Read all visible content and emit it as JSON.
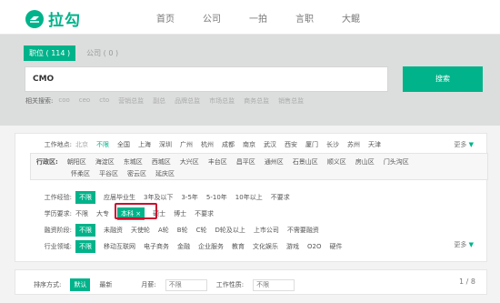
{
  "brand": {
    "name": "拉勾",
    "color": "#00b38a"
  },
  "nav": [
    "首页",
    "公司",
    "一拍",
    "言职",
    "大鲲"
  ],
  "tabs": [
    {
      "label": "职位 ( 114 )",
      "active": true
    },
    {
      "label": "公司 ( 0 )",
      "active": false
    }
  ],
  "search": {
    "value": "CMO",
    "button": "搜索"
  },
  "related": {
    "label": "相关搜索:",
    "tags": [
      "coo",
      "ceo",
      "cto",
      "营销总监",
      "副总",
      "品牌总监",
      "市场总监",
      "商务总监",
      "销售总监"
    ]
  },
  "filters": {
    "location": {
      "label": "工作地点:",
      "current": "北京",
      "options": [
        "不限",
        "全国",
        "上海",
        "深圳",
        "广州",
        "杭州",
        "成都",
        "南京",
        "武汉",
        "西安",
        "厦门",
        "长沙",
        "苏州",
        "天津"
      ],
      "selected": "不限",
      "more": "更多"
    },
    "district": {
      "label": "行政区:",
      "line1": [
        "朝阳区",
        "海淀区",
        "东城区",
        "西城区",
        "大兴区",
        "丰台区",
        "昌平区",
        "通州区",
        "石景山区",
        "顺义区",
        "房山区",
        "门头沟区"
      ],
      "line2": [
        "怀柔区",
        "平谷区",
        "密云区",
        "延庆区"
      ]
    },
    "experience": {
      "label": "工作经验:",
      "options": [
        "不限",
        "应届毕业生",
        "3年及以下",
        "3-5年",
        "5-10年",
        "10年以上",
        "不要求"
      ],
      "selected": "不限"
    },
    "education": {
      "label": "学历要求:",
      "options": [
        "不限",
        "大专",
        "本科 ×",
        "硕士",
        "博士",
        "不要求"
      ],
      "selected": "本科 ×"
    },
    "funding": {
      "label": "融资阶段:",
      "options": [
        "不限",
        "未融资",
        "天使轮",
        "A轮",
        "B轮",
        "C轮",
        "D轮及以上",
        "上市公司",
        "不需要融资"
      ],
      "selected": "不限"
    },
    "industry": {
      "label": "行业领域:",
      "options": [
        "不限",
        "移动互联网",
        "电子商务",
        "金融",
        "企业服务",
        "教育",
        "文化娱乐",
        "游戏",
        "O2O",
        "硬件"
      ],
      "selected": "不限",
      "more": "更多"
    }
  },
  "sortbar": {
    "label": "排序方式:",
    "options": [
      "默认",
      "最新"
    ],
    "selected": "默认",
    "salary_label": "月薪:",
    "salary_value": "不限",
    "nature_label": "工作性质:",
    "nature_value": "不限",
    "pager": "1 / 8"
  }
}
